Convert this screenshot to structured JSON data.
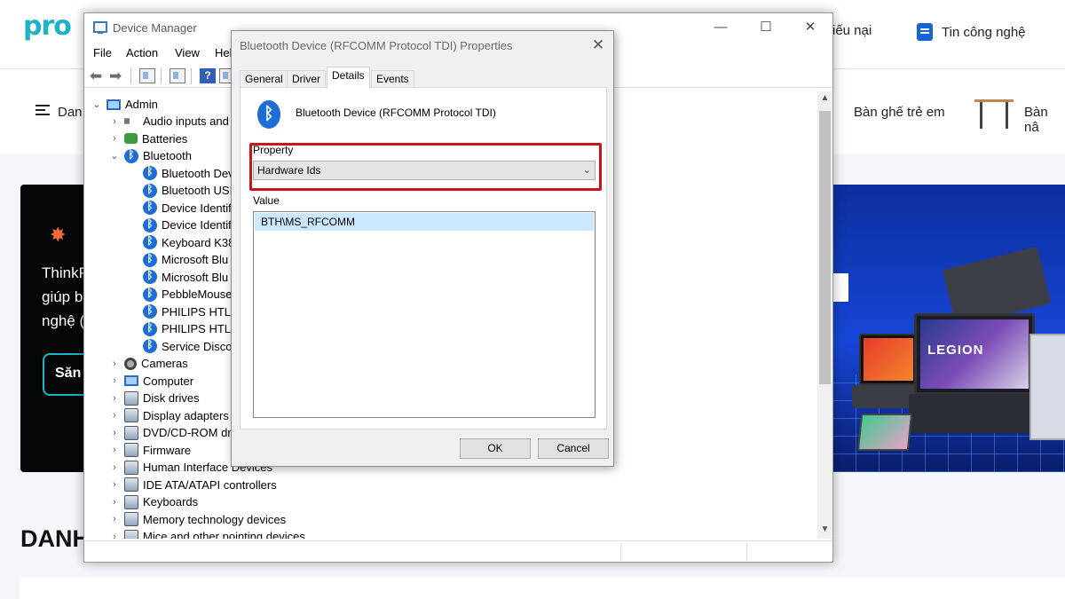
{
  "website": {
    "logo": "pro",
    "top_links": [
      {
        "label": "iếu nại"
      },
      {
        "label": "Tin công nghệ",
        "icon": "document-icon"
      }
    ],
    "nav": {
      "menu_label": "Dan",
      "items": [
        "Bàn ghế trẻ em",
        "Bàn nâ"
      ]
    },
    "promo": {
      "lines": [
        "ThinkP",
        "giúp b",
        "nghệ ("
      ],
      "button_label": "Săn"
    },
    "banner_text": "LEGION",
    "section_title": "DANH"
  },
  "device_manager": {
    "title": "Device Manager",
    "menu": [
      "File",
      "Action",
      "View",
      "Hel"
    ],
    "root": "Admin",
    "categories": [
      {
        "label": "Audio inputs and",
        "expanded": false,
        "icon": "speaker-icon"
      },
      {
        "label": "Batteries",
        "expanded": false,
        "icon": "battery-icon"
      },
      {
        "label": "Bluetooth",
        "expanded": true,
        "icon": "bluetooth-icon",
        "children": [
          "Bluetooth Dev",
          "Bluetooth USI",
          "Device Identif",
          "Device Identif",
          "Keyboard K38",
          "Microsoft Blu",
          "Microsoft Blu",
          "PebbleMouse",
          "PHILIPS HTL1",
          "PHILIPS HTL1",
          "Service Disco"
        ]
      },
      {
        "label": "Cameras",
        "expanded": false,
        "icon": "camera-icon"
      },
      {
        "label": "Computer",
        "expanded": false,
        "icon": "computer-icon"
      },
      {
        "label": "Disk drives",
        "expanded": false,
        "icon": "disk-icon"
      },
      {
        "label": "Display adapters",
        "expanded": false,
        "icon": "display-icon"
      },
      {
        "label": "DVD/CD-ROM dr",
        "expanded": false,
        "icon": "dvd-icon"
      },
      {
        "label": "Firmware",
        "expanded": false,
        "icon": "firmware-icon"
      },
      {
        "label": "Human Interface Devices",
        "expanded": false,
        "icon": "hid-icon"
      },
      {
        "label": "IDE ATA/ATAPI controllers",
        "expanded": false,
        "icon": "ide-icon"
      },
      {
        "label": "Keyboards",
        "expanded": false,
        "icon": "keyboard-icon"
      },
      {
        "label": "Memory technology devices",
        "expanded": false,
        "icon": "memory-icon"
      },
      {
        "label": "Mice and other pointing devices",
        "expanded": false,
        "icon": "mouse-icon"
      }
    ]
  },
  "dialog": {
    "title": "Bluetooth Device (RFCOMM Protocol TDI) Properties",
    "tabs": [
      "General",
      "Driver",
      "Details",
      "Events"
    ],
    "active_tab": "Details",
    "device_name": "Bluetooth Device (RFCOMM Protocol TDI)",
    "property_label": "Property",
    "property_value": "Hardware Ids",
    "value_label": "Value",
    "values": [
      "BTH\\MS_RFCOMM"
    ],
    "ok_label": "OK",
    "cancel_label": "Cancel",
    "highlight_color": "#c8151c"
  }
}
